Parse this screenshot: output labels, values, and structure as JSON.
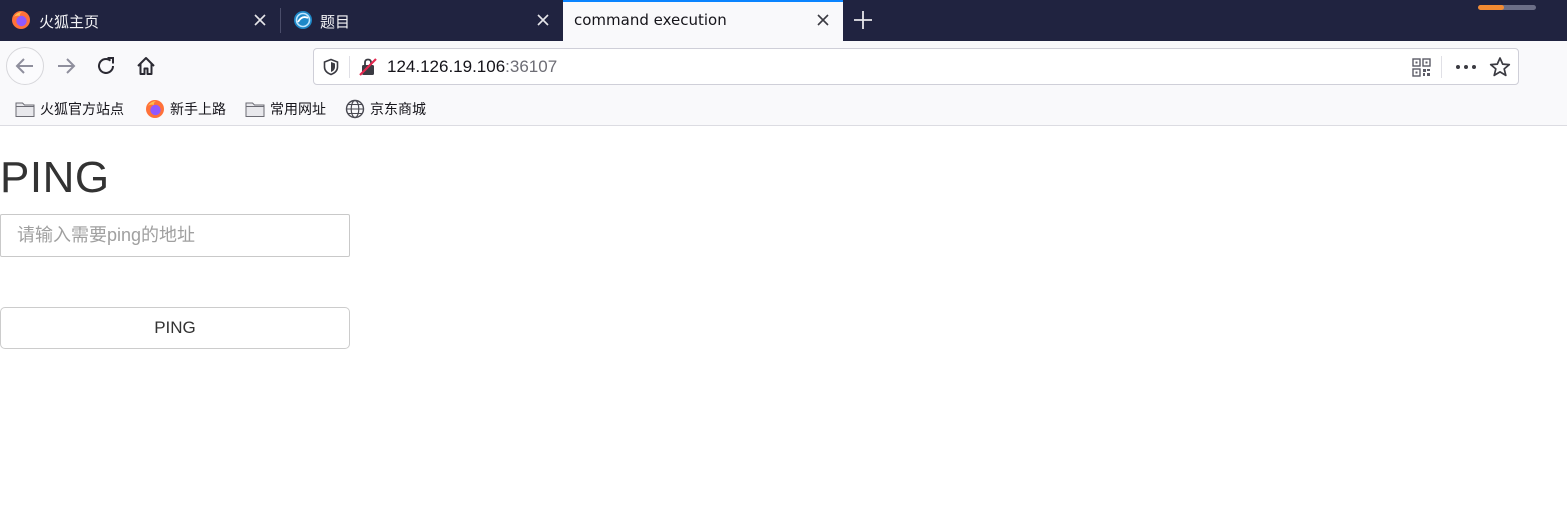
{
  "tabs": [
    {
      "title": "火狐主页",
      "icon": "firefox-icon"
    },
    {
      "title": "题目",
      "icon": "globe-favicon-icon"
    },
    {
      "title": "command execution",
      "icon": "",
      "active": true
    }
  ],
  "download_progress": 0.45,
  "toolbar": {
    "url_host": "124.126.19.106",
    "url_port": ":36107"
  },
  "bookmarks": [
    {
      "label": "火狐官方站点",
      "icon": "folder-icon"
    },
    {
      "label": "新手上路",
      "icon": "firefox-icon"
    },
    {
      "label": "常用网址",
      "icon": "folder-icon"
    },
    {
      "label": "京东商城",
      "icon": "globe-icon"
    }
  ],
  "page": {
    "heading": "PING",
    "input_placeholder": "请输入需要ping的地址",
    "input_value": "",
    "button_label": "PING"
  },
  "colors": {
    "tabstrip_bg": "#202340",
    "active_tab_accent": "#0a84ff",
    "toolbar_bg": "#f9f9fb"
  }
}
